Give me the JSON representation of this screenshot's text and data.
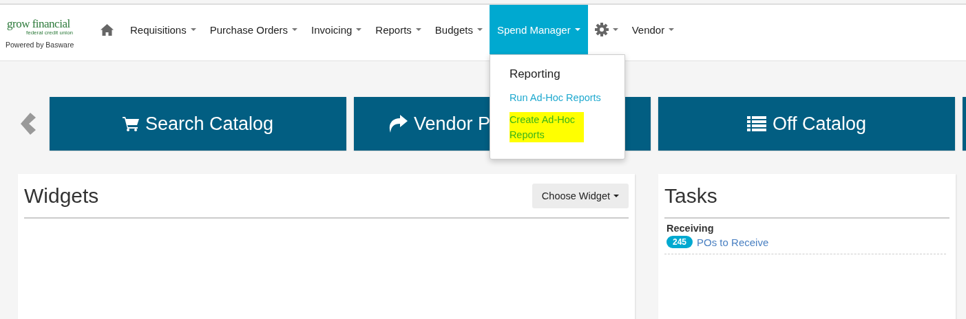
{
  "logo": {
    "name": "grow financial",
    "subtitle": "federal credit union",
    "powered_by": "Powered by Basware"
  },
  "nav": [
    {
      "kind": "home",
      "selected": false
    },
    {
      "kind": "menu",
      "label": "Requisitions",
      "selected": false
    },
    {
      "kind": "menu",
      "label": "Purchase Orders",
      "selected": false
    },
    {
      "kind": "menu",
      "label": "Invoicing",
      "selected": false
    },
    {
      "kind": "menu",
      "label": "Reports",
      "selected": false
    },
    {
      "kind": "menu",
      "label": "Budgets",
      "selected": false
    },
    {
      "kind": "menu",
      "label": "Spend Manager",
      "selected": true,
      "expanded": true
    },
    {
      "kind": "settings",
      "selected": false
    },
    {
      "kind": "menu",
      "label": "Vendor",
      "selected": false
    }
  ],
  "dropdown": {
    "header": "Reporting",
    "items": [
      {
        "label": "Run Ad-Hoc Reports",
        "highlighted": false
      },
      {
        "label": "Create Ad-Hoc Reports",
        "highlighted": true
      }
    ]
  },
  "tiles": [
    {
      "kind": "cart",
      "label": "Search Catalog"
    },
    {
      "kind": "share",
      "label": "Vendor P"
    },
    {
      "kind": "list",
      "label": "Off Catalog"
    },
    {
      "kind": "blank"
    }
  ],
  "widgets": {
    "title": "Widgets",
    "button": "Choose Widget"
  },
  "tasks": {
    "title": "Tasks",
    "groups": [
      {
        "title": "Receiving",
        "items": [
          {
            "count": "245",
            "label": "POs to Receive"
          }
        ]
      }
    ]
  }
}
